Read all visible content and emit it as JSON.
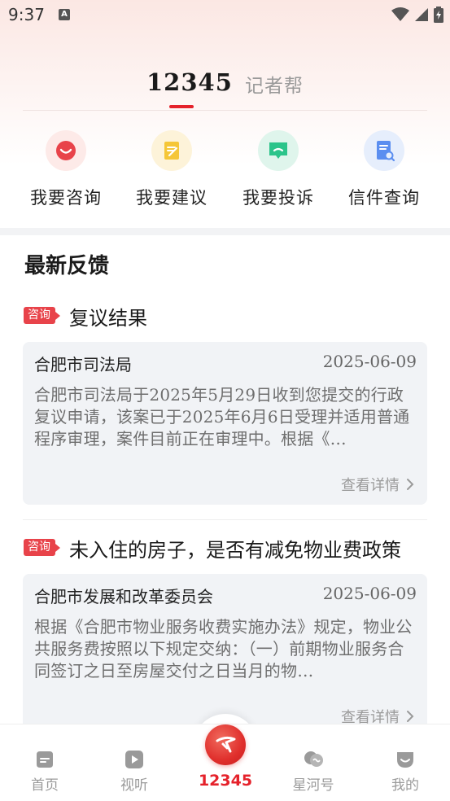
{
  "status_bar": {
    "time": "9:37",
    "notification_letter": "A"
  },
  "tabs": {
    "primary": "12345",
    "secondary": "记者帮"
  },
  "actions": [
    {
      "label": "我要咨询",
      "icon": "chat-smile-icon",
      "color": "#e8434a",
      "bg": "#fdeae8"
    },
    {
      "label": "我要建议",
      "icon": "note-edit-icon",
      "color": "#f5c638",
      "bg": "#fdf3d9"
    },
    {
      "label": "我要投诉",
      "icon": "message-complaint-icon",
      "color": "#2bc48a",
      "bg": "#dff5ec"
    },
    {
      "label": "信件查询",
      "icon": "document-search-icon",
      "color": "#5b8ef0",
      "bg": "#e6eefc"
    }
  ],
  "feedback_section": {
    "title": "最新反馈"
  },
  "feedback": [
    {
      "tag": "咨询",
      "title": "复议结果",
      "org": "合肥市司法局",
      "date": "2025-06-09",
      "text": "合肥市司法局于2025年5月29日收到您提交的行政复议申请，该案已于2025年6月6日受理并适用普通程序审理，案件目前正在审理中。根据《…",
      "more": "查看详情"
    },
    {
      "tag": "咨询",
      "title": "未入住的房子，是否有减免物业费政策",
      "org": "合肥市发展和改革委员会",
      "date": "2025-06-09",
      "text": "根据《合肥市物业服务收费实施办法》规定，物业公共服务费按照以下规定交纳：（一）前期物业服务合同签订之日至房屋交付之日当月的物…",
      "more": "查看详情"
    }
  ],
  "bottom_nav": {
    "items": [
      {
        "label": "首页",
        "icon": "home-doc-icon"
      },
      {
        "label": "视听",
        "icon": "play-icon"
      },
      {
        "label": "12345",
        "icon": "hotline-logo-icon",
        "active": true
      },
      {
        "label": "星河号",
        "icon": "chat-bubbles-icon"
      },
      {
        "label": "我的",
        "icon": "profile-smile-icon"
      }
    ],
    "active_color": "#e5222b",
    "inactive_color": "#9a9a9a"
  }
}
